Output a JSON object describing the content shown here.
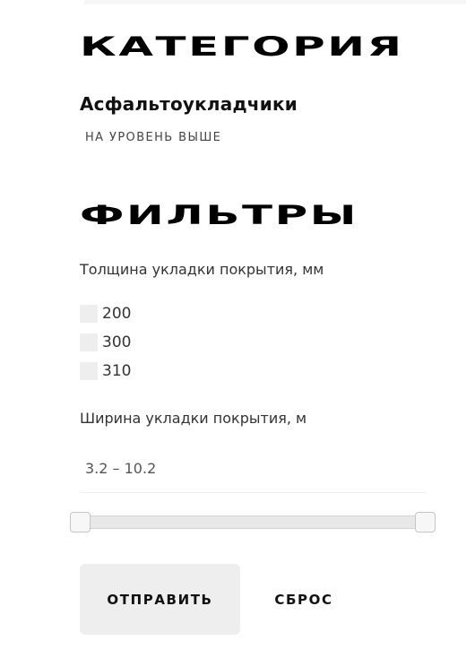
{
  "category": {
    "heading": "КАТЕГОРИЯ",
    "current": "Асфальтоукладчики",
    "up_link": "НА УРОВЕНЬ ВЫШЕ"
  },
  "filters": {
    "heading": "ФИЛЬТРЫ",
    "thickness": {
      "label": "Толщина укладки покрытия, мм",
      "options": [
        {
          "label": "200",
          "checked": false
        },
        {
          "label": "300",
          "checked": false
        },
        {
          "label": "310",
          "checked": false
        }
      ]
    },
    "width": {
      "label": "Ширина укладки покрытия, м",
      "range_text": "3.2 – 10.2",
      "min": 3.2,
      "max": 10.2
    },
    "submit_label": "ОТПРАВИТЬ",
    "reset_label": "СБРОС"
  }
}
